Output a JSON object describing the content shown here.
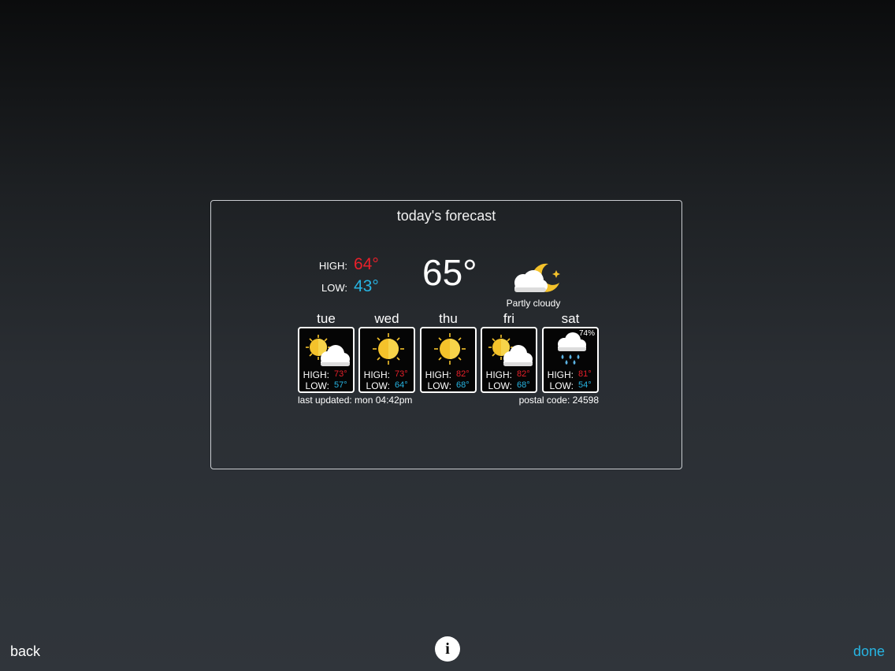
{
  "panel": {
    "title": "today's forecast",
    "high_label": "HIGH:",
    "high_value": "64°",
    "low_label": "LOW:",
    "low_value": "43°",
    "current_temp": "65°",
    "condition": "Partly cloudy",
    "condition_icon": "partly-cloudy-night-icon"
  },
  "forecast": [
    {
      "day": "tue",
      "icon": "partly-cloudy-icon",
      "high_label": "HIGH:",
      "high": "73°",
      "low_label": "LOW:",
      "low": "57°",
      "precip": ""
    },
    {
      "day": "wed",
      "icon": "sunny-icon",
      "high_label": "HIGH:",
      "high": "73°",
      "low_label": "LOW:",
      "low": "64°",
      "precip": ""
    },
    {
      "day": "thu",
      "icon": "sunny-icon",
      "high_label": "HIGH:",
      "high": "82°",
      "low_label": "LOW:",
      "low": "68°",
      "precip": ""
    },
    {
      "day": "fri",
      "icon": "partly-cloudy-icon",
      "high_label": "HIGH:",
      "high": "82°",
      "low_label": "LOW:",
      "low": "68°",
      "precip": ""
    },
    {
      "day": "sat",
      "icon": "rain-icon",
      "high_label": "HIGH:",
      "high": "81°",
      "low_label": "LOW:",
      "low": "54°",
      "precip": "74%"
    }
  ],
  "footer": {
    "last_updated": "last updated: mon 04:42pm",
    "postal_code": "postal code: 24598"
  },
  "nav": {
    "back_label": "back",
    "done_label": "done",
    "info_label": "i"
  },
  "colors": {
    "high": "#e8202a",
    "low": "#27b4e2",
    "accent": "#27b4e2"
  }
}
